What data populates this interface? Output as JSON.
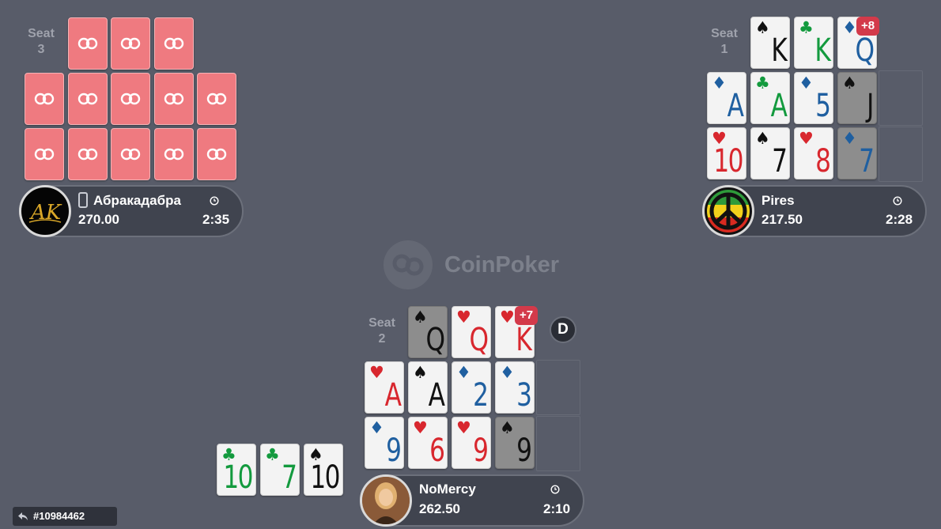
{
  "branding": {
    "logo_text": "CoinPoker"
  },
  "hand_id": "#10984462",
  "colors": {
    "background": "#585c69",
    "spade": "#111111",
    "heart": "#d8272e",
    "diamond": "#1f5fa0",
    "club": "#139a3e",
    "card_back": "#ef7a80",
    "badge": "#d33a4a"
  },
  "seat3": {
    "label_seat": "Seat",
    "label_num": "3",
    "player": {
      "name": "Абракадабра",
      "stack": "270.00",
      "time": "2:35",
      "device_icon": "phone-icon",
      "avatar": "ak-logo-avatar"
    }
  },
  "seat1": {
    "label_seat": "Seat",
    "label_num": "1",
    "badge": "+8",
    "player": {
      "name": "Pires",
      "stack": "217.50",
      "time": "2:28",
      "avatar": "peace-sign-avatar"
    },
    "cards": [
      {
        "rank": "K",
        "suit": "♠",
        "color": "#111111",
        "dim": false
      },
      {
        "rank": "K",
        "suit": "♣",
        "color": "#139a3e",
        "dim": false
      },
      {
        "rank": "Q",
        "suit": "♦",
        "color": "#1f5fa0",
        "dim": false
      },
      {
        "rank": "A",
        "suit": "♦",
        "color": "#1f5fa0",
        "dim": false
      },
      {
        "rank": "A",
        "suit": "♣",
        "color": "#139a3e",
        "dim": false
      },
      {
        "rank": "5",
        "suit": "♦",
        "color": "#1f5fa0",
        "dim": false
      },
      {
        "rank": "J",
        "suit": "♠",
        "color": "#111111",
        "dim": true
      },
      {
        "rank": "10",
        "suit": "♥",
        "color": "#d8272e",
        "dim": false
      },
      {
        "rank": "7",
        "suit": "♠",
        "color": "#111111",
        "dim": false
      },
      {
        "rank": "8",
        "suit": "♥",
        "color": "#d8272e",
        "dim": false
      },
      {
        "rank": "7",
        "suit": "♦",
        "color": "#1f5fa0",
        "dim": true
      }
    ]
  },
  "seat2": {
    "label_seat": "Seat",
    "label_num": "2",
    "badge": "+7",
    "dealer": "D",
    "player": {
      "name": "NoMercy",
      "stack": "262.50",
      "time": "2:10",
      "avatar": "woman-photo-avatar"
    },
    "cards": [
      {
        "rank": "Q",
        "suit": "♠",
        "color": "#111111",
        "dim": true
      },
      {
        "rank": "Q",
        "suit": "♥",
        "color": "#d8272e",
        "dim": false
      },
      {
        "rank": "K",
        "suit": "♥",
        "color": "#d8272e",
        "dim": false
      },
      {
        "rank": "A",
        "suit": "♥",
        "color": "#d8272e",
        "dim": false
      },
      {
        "rank": "A",
        "suit": "♠",
        "color": "#111111",
        "dim": false
      },
      {
        "rank": "2",
        "suit": "♦",
        "color": "#1f5fa0",
        "dim": false
      },
      {
        "rank": "3",
        "suit": "♦",
        "color": "#1f5fa0",
        "dim": false
      },
      {
        "rank": "9",
        "suit": "♦",
        "color": "#1f5fa0",
        "dim": false
      },
      {
        "rank": "6",
        "suit": "♥",
        "color": "#d8272e",
        "dim": false
      },
      {
        "rank": "9",
        "suit": "♥",
        "color": "#d8272e",
        "dim": false
      },
      {
        "rank": "9",
        "suit": "♠",
        "color": "#111111",
        "dim": true
      }
    ],
    "hand": [
      {
        "rank": "10",
        "suit": "♣",
        "color": "#139a3e",
        "dim": false
      },
      {
        "rank": "7",
        "suit": "♣",
        "color": "#139a3e",
        "dim": false
      },
      {
        "rank": "10",
        "suit": "♠",
        "color": "#111111",
        "dim": false
      }
    ]
  }
}
